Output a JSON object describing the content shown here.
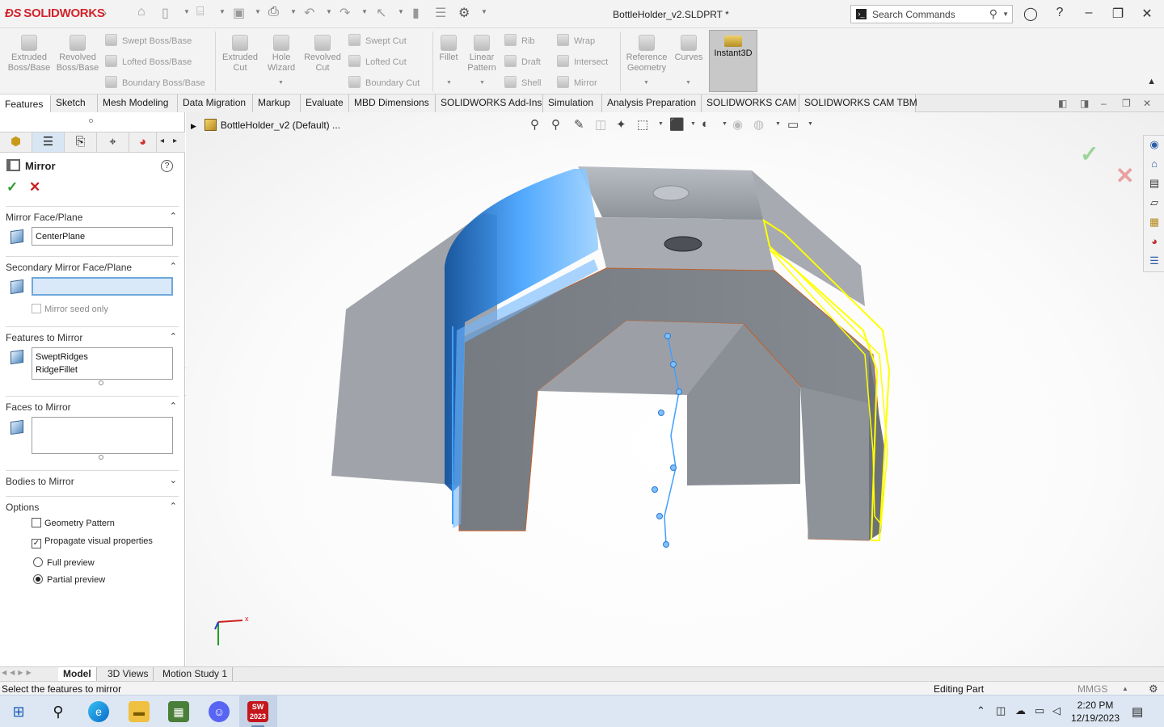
{
  "app": {
    "brand": "SOLIDWORKS",
    "document_title": "BottleHolder_v2.SLDPRT *",
    "search_placeholder": "Search Commands",
    "icons": [
      "home-icon",
      "new-icon",
      "open-icon",
      "save-icon",
      "print-icon",
      "undo-icon",
      "redo-icon",
      "select-icon",
      "rebuild-icon",
      "file-properties-icon",
      "options-icon",
      "user-icon",
      "help-icon",
      "minimize-icon",
      "restore-icon",
      "close-icon"
    ]
  },
  "commands": {
    "large": [
      {
        "id": "extruded-boss",
        "label1": "Extruded",
        "label2": "Boss/Base"
      },
      {
        "id": "revolved-boss",
        "label1": "Revolved",
        "label2": "Boss/Base"
      },
      {
        "id": "extruded-cut",
        "label1": "Extruded",
        "label2": "Cut"
      },
      {
        "id": "hole-wizard",
        "label1": "Hole",
        "label2": "Wizard"
      },
      {
        "id": "revolved-cut",
        "label1": "Revolved",
        "label2": "Cut"
      },
      {
        "id": "fillet",
        "label1": "Fillet",
        "label2": ""
      },
      {
        "id": "linear-pattern",
        "label1": "Linear",
        "label2": "Pattern"
      },
      {
        "id": "reference-geometry",
        "label1": "Reference",
        "label2": "Geometry"
      },
      {
        "id": "curves",
        "label1": "Curves",
        "label2": ""
      }
    ],
    "small": {
      "swept_boss": "Swept Boss/Base",
      "lofted_boss": "Lofted Boss/Base",
      "boundary_boss": "Boundary Boss/Base",
      "swept_cut": "Swept Cut",
      "lofted_cut": "Lofted Cut",
      "boundary_cut": "Boundary Cut",
      "rib": "Rib",
      "draft": "Draft",
      "shell": "Shell",
      "wrap": "Wrap",
      "intersect": "Intersect",
      "mirror": "Mirror"
    },
    "instant3d": "Instant3D"
  },
  "tabs": [
    "Features",
    "Sketch",
    "Mesh Modeling",
    "Data Migration",
    "Markup",
    "Evaluate",
    "MBD Dimensions",
    "SOLIDWORKS Add-Ins",
    "Simulation",
    "Analysis Preparation",
    "SOLIDWORKS CAM",
    "SOLIDWORKS CAM TBM"
  ],
  "active_tab": "Features",
  "property_manager": {
    "title": "Mirror",
    "groups": {
      "mirror_face": {
        "label": "Mirror Face/Plane",
        "value": "CenterPlane"
      },
      "secondary": {
        "label": "Secondary Mirror Face/Plane",
        "value": "",
        "mirror_seed_only": "Mirror seed only"
      },
      "features": {
        "label": "Features to Mirror",
        "items": [
          "SweptRidges",
          "RidgeFillet"
        ]
      },
      "faces": {
        "label": "Faces to Mirror"
      },
      "bodies": {
        "label": "Bodies to Mirror"
      },
      "options": {
        "label": "Options",
        "geometry_pattern": "Geometry Pattern",
        "propagate": "Propagate visual properties",
        "full_preview": "Full preview",
        "partial_preview": "Partial preview"
      }
    },
    "state": {
      "geometry_pattern": false,
      "propagate": true,
      "preview": "partial"
    }
  },
  "viewport": {
    "tree_label": "BottleHolder_v2  (Default) ...",
    "triad_x": "x"
  },
  "bottom_tabs": [
    "Model",
    "3D Views",
    "Motion Study 1"
  ],
  "active_bottom_tab": "Model",
  "status": {
    "message": "Select the features to mirror",
    "mode": "Editing Part",
    "units": "MMGS"
  },
  "taskbar": {
    "time": "2:20 PM",
    "date": "12/19/2023",
    "solidworks_badge": "SW 2023"
  },
  "colors": {
    "brand_red": "#d2232a",
    "preview_yellow": "#ffff00",
    "selection_blue": "#3fa0ff",
    "part_gray": "#8e949c"
  }
}
